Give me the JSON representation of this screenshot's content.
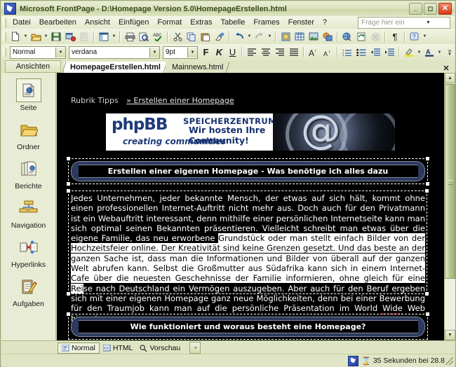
{
  "window": {
    "title": "Microsoft FrontPage - D:\\Homepage Version 5.0\\HomepageErstellen.html",
    "app_icon": "frontpage-icon",
    "minimize_label": "_",
    "maximize_label": "▭",
    "close_label": "✕"
  },
  "menu": {
    "items": [
      {
        "label": "Datei"
      },
      {
        "label": "Bearbeiten"
      },
      {
        "label": "Ansicht"
      },
      {
        "label": "Einfügen"
      },
      {
        "label": "Format"
      },
      {
        "label": "Extras"
      },
      {
        "label": "Tabelle"
      },
      {
        "label": "Frames"
      },
      {
        "label": "Fenster"
      },
      {
        "label": "?"
      }
    ],
    "ask_box": {
      "placeholder": "Frage hier eingeben",
      "value": "Frage hier eingeben",
      "arrow": "▼"
    }
  },
  "standard_toolbar": {
    "buttons": [
      {
        "name": "new-page-icon",
        "glyph": "□"
      },
      {
        "name": "open-icon",
        "glyph": "📂"
      },
      {
        "name": "save-icon",
        "glyph": "💾"
      },
      {
        "name": "publish-web-icon",
        "glyph": "⌘"
      },
      {
        "name": "toggle-folder-list-icon",
        "glyph": "▤"
      },
      {
        "name": "print-icon",
        "glyph": "⎙"
      },
      {
        "name": "print-preview-icon",
        "glyph": "🔍"
      },
      {
        "name": "spelling-icon",
        "glyph": "ABC"
      },
      {
        "name": "cut-icon",
        "glyph": "✂"
      },
      {
        "name": "copy-icon",
        "glyph": "⧉"
      },
      {
        "name": "paste-icon",
        "glyph": "📋"
      },
      {
        "name": "format-painter-icon",
        "glyph": "✐"
      },
      {
        "name": "undo-icon",
        "glyph": "↶"
      },
      {
        "name": "redo-icon",
        "glyph": "↷"
      },
      {
        "name": "web-component-icon",
        "glyph": "▣"
      },
      {
        "name": "insert-table-icon",
        "glyph": "▦"
      },
      {
        "name": "insert-picture-icon",
        "glyph": "🖼"
      },
      {
        "name": "drawing-icon",
        "glyph": "◐"
      },
      {
        "name": "hyperlink-icon",
        "glyph": "🌐"
      },
      {
        "name": "refresh-icon",
        "glyph": "⟳"
      },
      {
        "name": "stop-icon",
        "glyph": "⊗"
      },
      {
        "name": "show-all-icon",
        "glyph": "¶"
      },
      {
        "name": "help-icon",
        "glyph": "?"
      }
    ]
  },
  "formatting_toolbar": {
    "style": {
      "label": "Normal",
      "arrow": "▼"
    },
    "font": {
      "label": "verdana",
      "arrow": "▼"
    },
    "size": {
      "label": "9pt",
      "arrow": "▼"
    },
    "bold": "F",
    "italic": "K",
    "underline": "U",
    "buttons": [
      {
        "name": "align-left-icon",
        "glyph": "☰"
      },
      {
        "name": "align-center-icon",
        "glyph": "☰"
      },
      {
        "name": "align-right-icon",
        "glyph": "☰"
      },
      {
        "name": "justify-icon",
        "glyph": "☰"
      },
      {
        "name": "increase-font-size-icon",
        "glyph": "A"
      },
      {
        "name": "decrease-font-size-icon",
        "glyph": "A"
      },
      {
        "name": "numbered-list-icon",
        "glyph": "≡"
      },
      {
        "name": "bulleted-list-icon",
        "glyph": "≡"
      },
      {
        "name": "decrease-indent-icon",
        "glyph": "⇤"
      },
      {
        "name": "increase-indent-icon",
        "glyph": "⇥"
      },
      {
        "name": "highlight-color-icon",
        "glyph": "✎"
      },
      {
        "name": "font-color-icon",
        "glyph": "A"
      }
    ],
    "overflow": "»"
  },
  "views_bar": {
    "header": "Ansichten",
    "items": [
      {
        "label": "Seite",
        "icon": "page-view-icon",
        "active": true
      },
      {
        "label": "Ordner",
        "icon": "folder-view-icon",
        "active": false
      },
      {
        "label": "Berichte",
        "icon": "reports-view-icon",
        "active": false
      },
      {
        "label": "Navigation",
        "icon": "navigation-view-icon",
        "active": false
      },
      {
        "label": "Hyperlinks",
        "icon": "hyperlinks-view-icon",
        "active": false
      },
      {
        "label": "Aufgaben",
        "icon": "tasks-view-icon",
        "active": false
      }
    ]
  },
  "document_tabs": {
    "tabs": [
      {
        "label": "HomepageErstellen.html",
        "active": true
      },
      {
        "label": "Mainnews.html",
        "active": false
      }
    ],
    "close_label": "✕"
  },
  "page": {
    "breadcrumb_label": "Rubrik Tipps",
    "breadcrumb_link": "» Erstellen einer Homepage",
    "banner": {
      "logo": "phpBB",
      "logo_sub": "creating communities",
      "headline1": "SPEICHERZENTRUM",
      "headline2": "Wir hosten Ihre Community!",
      "at_symbol": "@"
    },
    "heading_top": "Erstellen einer eigenen Homepage - Was benötige ich alles dazu",
    "heading_bottom": "Wie funktioniert und woraus besteht eine Homepage?",
    "body_part1": "Jedes Unternehmen, jeder bekannte Mensch, der etwas auf sich hält, kommt ohne einen professionellen Internet-Auftritt nicht mehr aus. Doch auch für den Privatmann ist ein Webauftritt interessant, denn mithilfe einer persönlichen Internetseite kann man sich optimal seinen Bekannten präsentieren. Vielleicht schreibt man etwas über die eigene Familie, das neu erworbene ",
    "body_selected": "Grundstück oder man stellt einfach Bilder von der Hochzeitsfeier online. Der Kreativität sind keine Grenzen gesetzt. Und das beste an der ganzen Sache ist, dass man die Informationen und Bilder von überall auf der ganzen Welt abrufen kann. Selbst die Großmutter aus Südafrika kann sich in einem Internet-Cafe über die neuesten Geschehnisse der Familie informieren, ohne gleich für eine Rei",
    "body_part3": "se nach Deutschland ein Vermögen auszugeben. Aber auch für den Beruf ergeben sich mit einer eigenen Homepage ganz neue Möglichkeiten, denn bei einer Bewerbung für den Traumjob kann man auf die persönliche Präsentation im World ",
    "body_misspelled": "Wide",
    "body_part4": " Web hinweisen."
  },
  "view_tabs": {
    "tabs": [
      {
        "label": "Normal",
        "icon": "normal-view-icon",
        "active": true
      },
      {
        "label": "HTML",
        "icon": "html-view-icon",
        "active": false
      },
      {
        "label": "Vorschau",
        "icon": "preview-view-icon",
        "active": false
      }
    ],
    "more_label": "◂"
  },
  "status_bar": {
    "estimate": "35 Sekunden bei 28.8",
    "fp_icon": "frontpage-icon",
    "hourglass_icon": "hourglass-icon"
  },
  "scrollbar": {
    "up_arrow": "▲",
    "down_arrow": "▼",
    "left_arrow": "◀"
  },
  "colors": {
    "chrome": "#dfe5c4",
    "page_background": "#000000",
    "heading_bar": "#2c3a5e",
    "accent_blue": "#16306e",
    "spell_error": "#c02020"
  }
}
